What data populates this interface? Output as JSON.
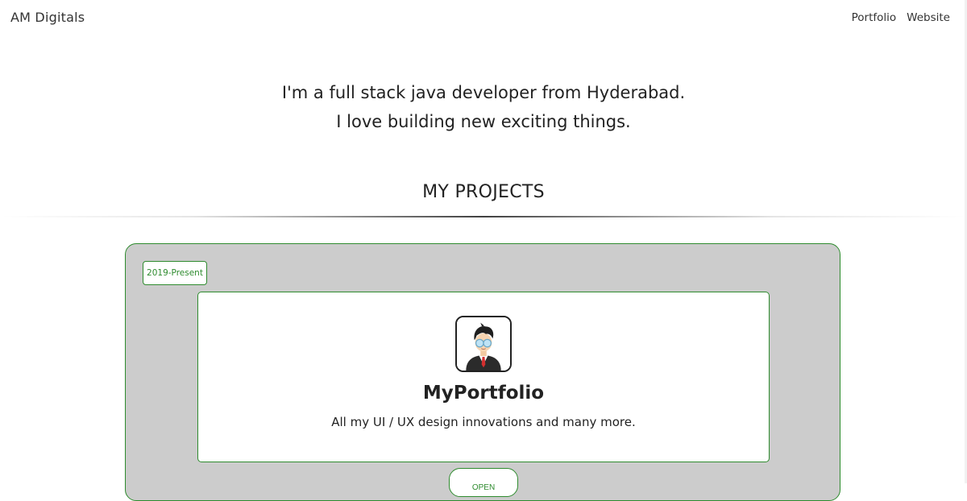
{
  "navbar": {
    "brand": "AM Digitals",
    "links": [
      "Portfolio",
      "Website"
    ]
  },
  "intro": {
    "line1": "I'm a full stack java developer from Hyderabad.",
    "line2": "I love building new exciting things."
  },
  "section": {
    "title": "MY PROJECTS"
  },
  "project": {
    "period": "2019-Present",
    "logo_icon": "developer-avatar-icon",
    "title": "MyPortfolio",
    "description": "All my UI / UX design innovations and many more.",
    "open_label": "OPEN"
  },
  "colors": {
    "accent": "#2e8b2e",
    "panel": "#cccccc",
    "text": "#222222"
  }
}
